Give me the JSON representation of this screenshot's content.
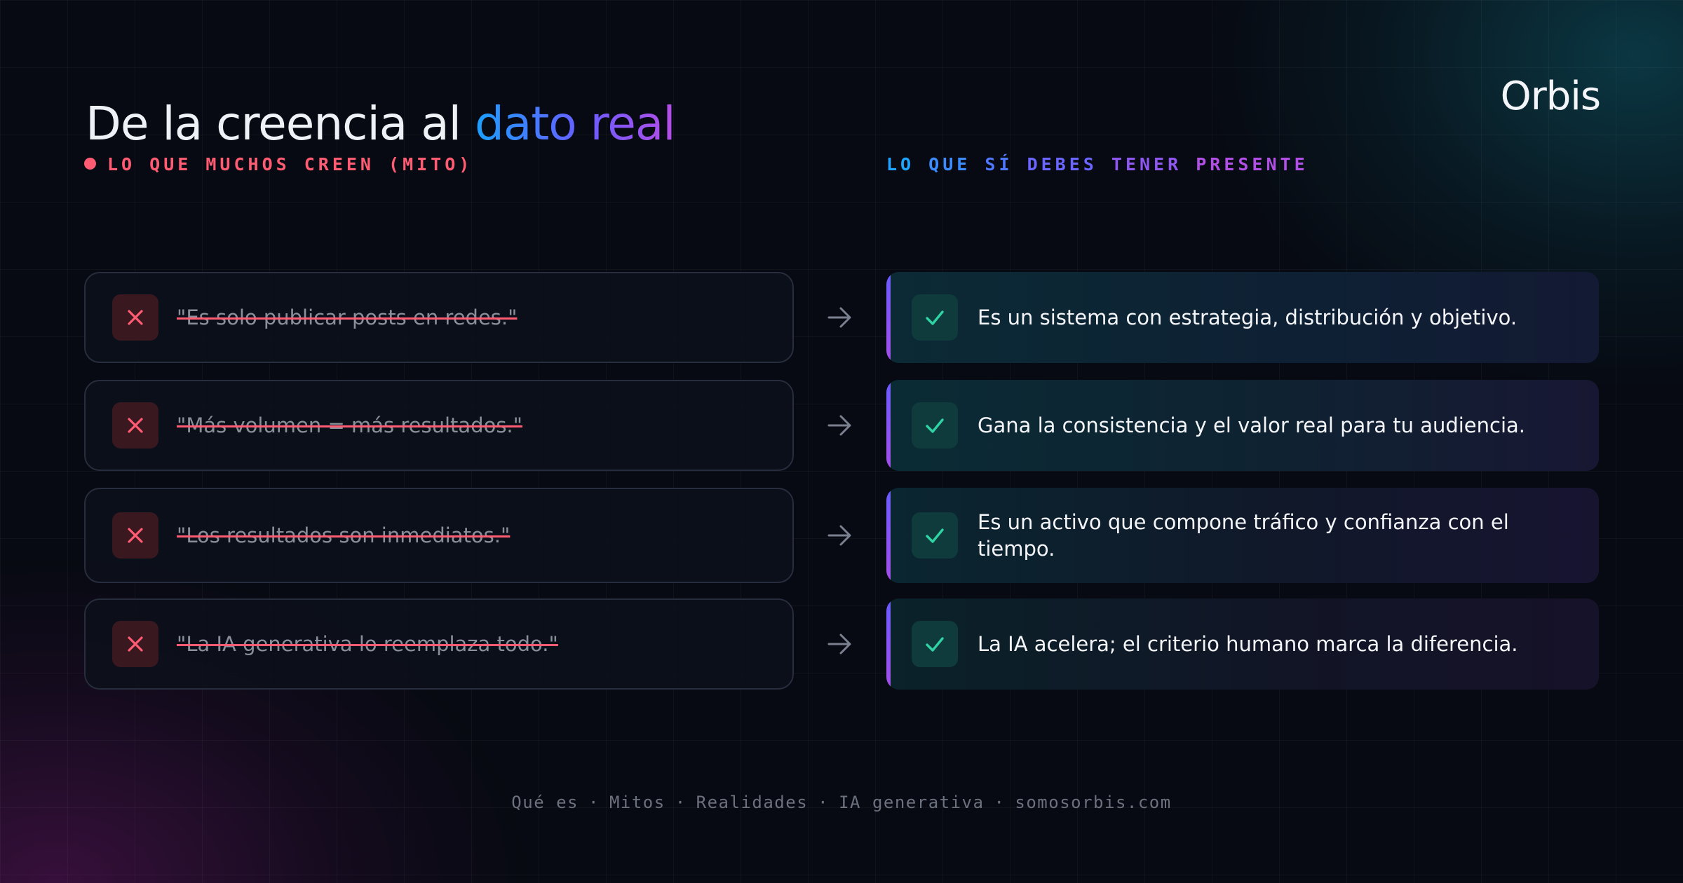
{
  "header": {
    "title_prefix": "De la creencia al ",
    "title_accent": "dato real",
    "logo": "Orbis"
  },
  "labels": {
    "myth": "LO QUE MUCHOS CREEN (MITO)",
    "fact_words": [
      "LO",
      "QUE",
      "SÍ",
      "DEBES",
      "TENER",
      "PRESENTE"
    ]
  },
  "rows": [
    {
      "myth": "\"Es solo publicar posts en redes.\"",
      "fact": "Es un sistema con estrategia, distribución y objetivo."
    },
    {
      "myth": "\"Más volumen = más resultados.\"",
      "fact": "Gana la consistencia y el valor real para tu audiencia."
    },
    {
      "myth": "\"Los resultados son inmediatos.\"",
      "fact": "Es un activo que compone tráfico y confianza con el tiempo."
    },
    {
      "myth": "\"La IA generativa lo reemplaza todo.\"",
      "fact": "La IA acelera; el criterio humano marca la diferencia."
    }
  ],
  "footer": {
    "items": [
      "Qué es",
      "Mitos",
      "Realidades",
      "IA generativa",
      "somosorbis.com"
    ],
    "separator": "·"
  },
  "icons": {
    "myth_badge": "x-icon",
    "fact_badge": "check-icon",
    "connector": "arrow-right-icon"
  },
  "colors": {
    "myth_accent": "#ff5c73",
    "fact_check": "#2fd4a4",
    "gradient_start": "#1aa0ff",
    "gradient_end": "#b54ee6"
  }
}
